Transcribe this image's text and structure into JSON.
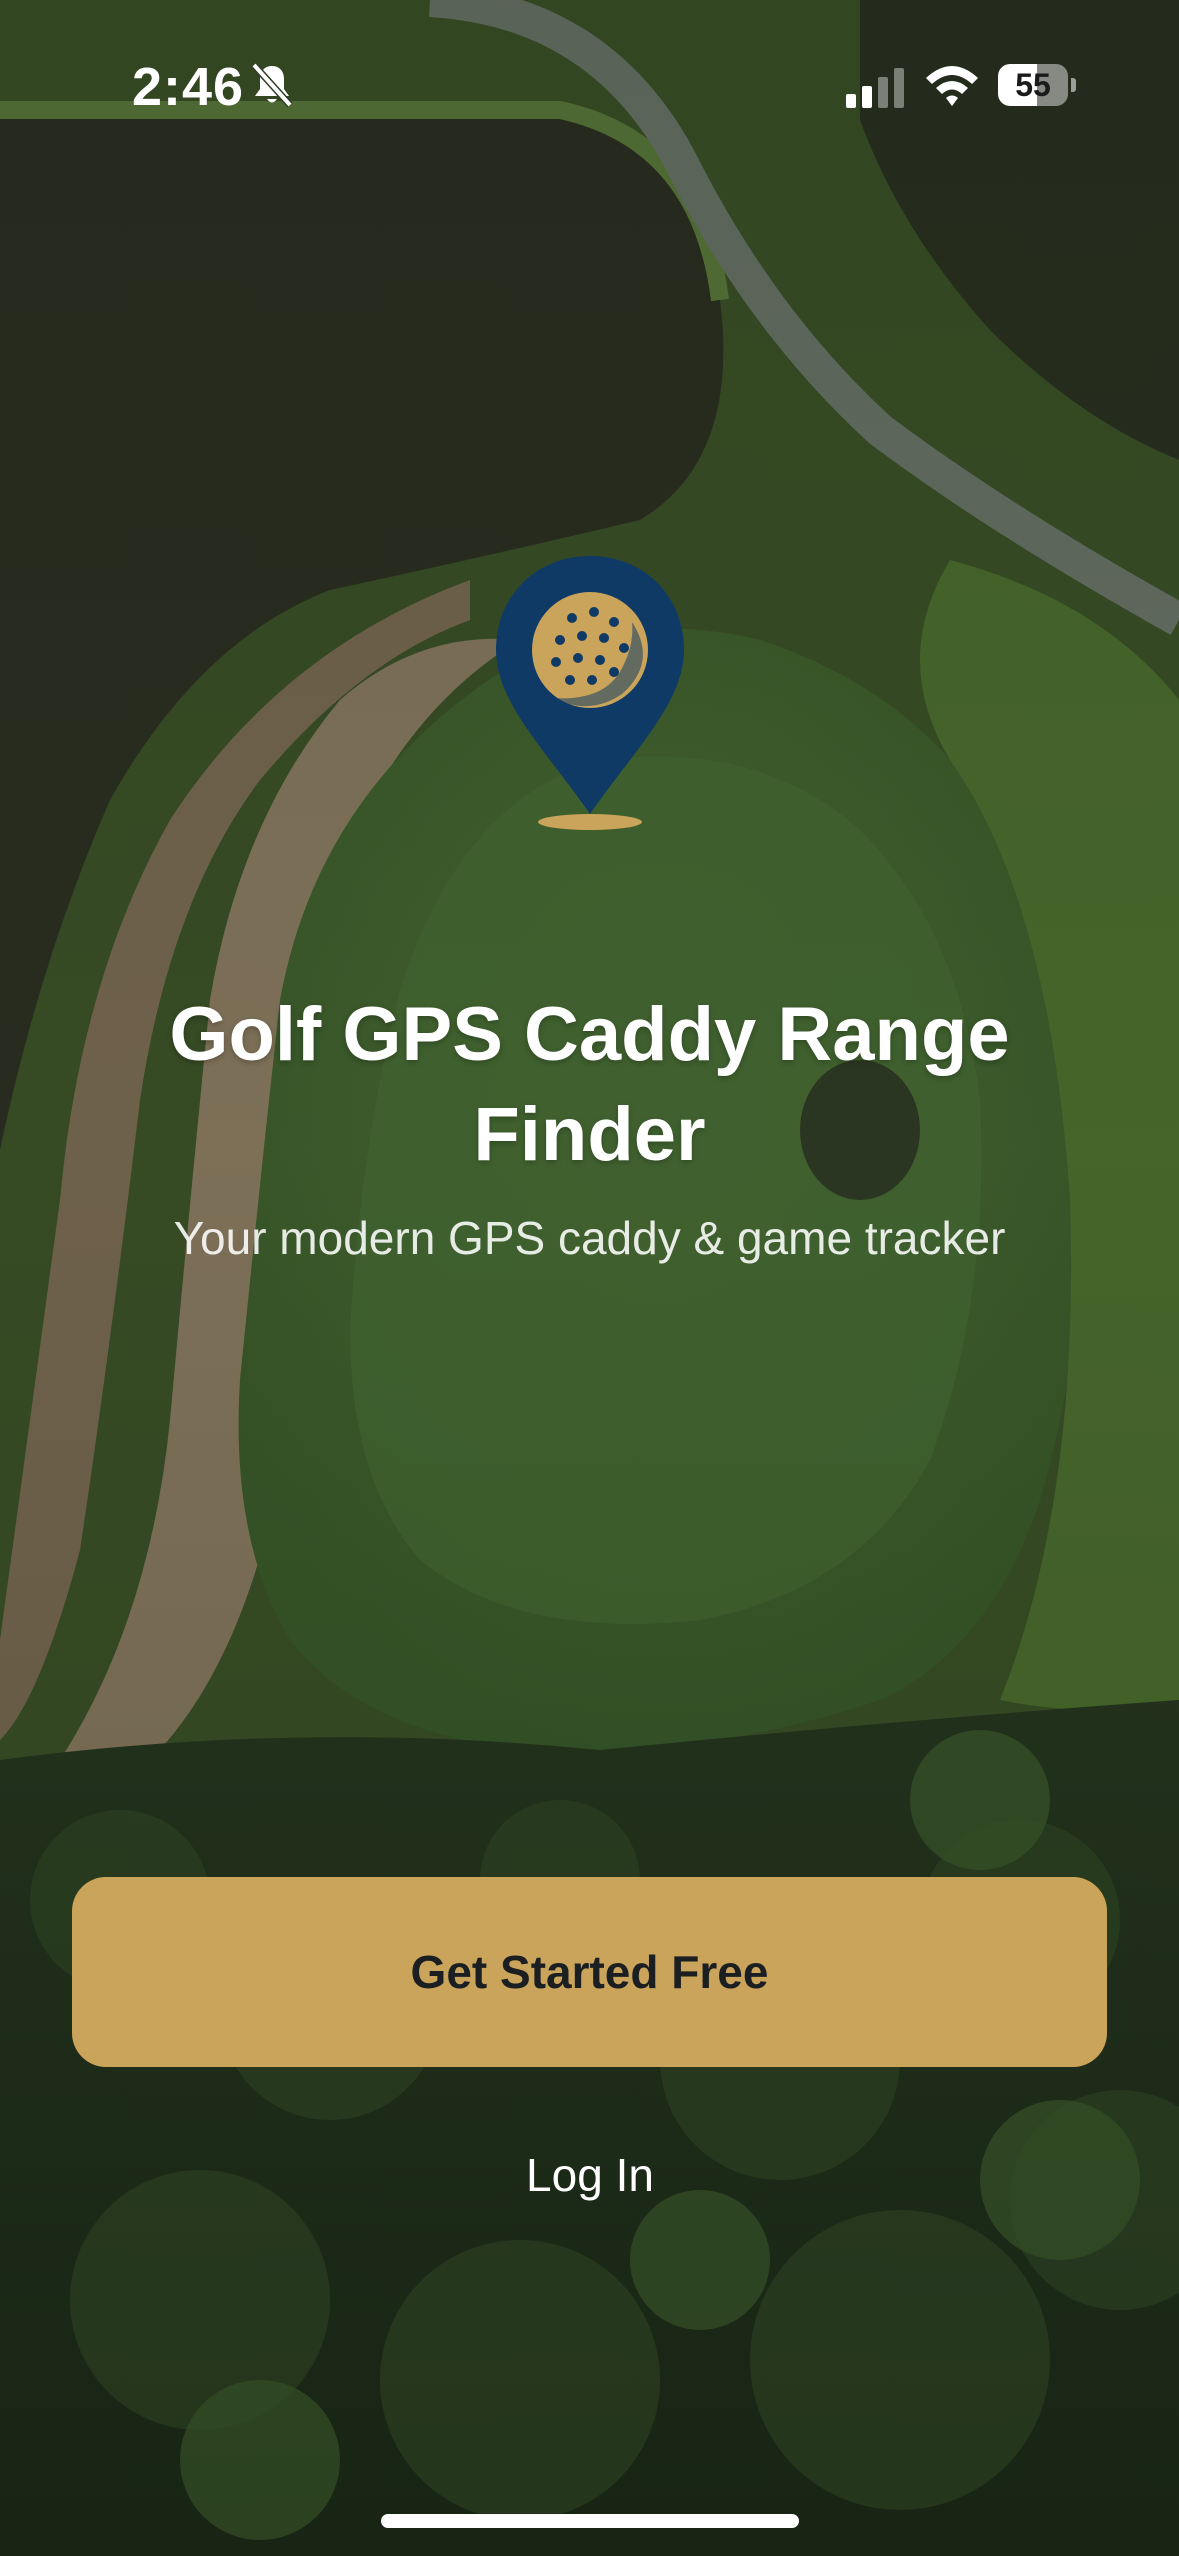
{
  "status_bar": {
    "time": "2:46",
    "battery_level": "55",
    "battery_fraction": 0.55,
    "icons": [
      "bell-slash-icon",
      "cellular-signal-icon",
      "wifi-icon",
      "battery-icon"
    ]
  },
  "logo": {
    "icon": "map-pin-golf-ball-icon",
    "pin_color": "#0f3a66",
    "ball_color": "#c9a45a"
  },
  "hero": {
    "title": "Golf GPS Caddy Range Finder",
    "subtitle": "Your modern GPS caddy & game tracker"
  },
  "actions": {
    "primary_label": "Get Started Free",
    "secondary_label": "Log In",
    "primary_color": "#c9a45a"
  }
}
